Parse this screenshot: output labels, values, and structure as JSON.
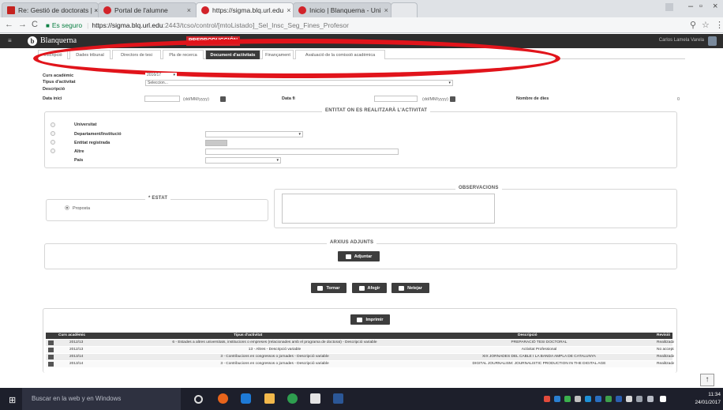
{
  "browser": {
    "tabs": [
      {
        "label": "Re: Gestió de doctorats | ×",
        "icon_color": "#c5221f"
      },
      {
        "label": "Portal de l'alumne",
        "icon_color": "#d2232a"
      },
      {
        "label": "https://sigma.blq.url.edu",
        "icon_color": "#d2232a"
      },
      {
        "label": "Inicio | Blanquerna - Uni",
        "icon_color": "#d2232a"
      }
    ],
    "secure_label": "Es seguro",
    "url_host": "https://sigma.blq.url.edu",
    "url_path": ":2443/tcso/control/[mtoListado]_Sel_Insc_Seg_Fines_Profesor"
  },
  "app": {
    "logo_letter": "b",
    "brand": "Blanquerna",
    "env_badge": "PREPRODUCCIÓN",
    "user_name": "Carlos Lamela Varela"
  },
  "subtabs": [
    "Inscripció",
    "Dades tribunal",
    "Directors de tesi",
    "Pla de recerca",
    "Document d'activitats",
    "Finançament",
    "Avaluació de la comissió acadèmica"
  ],
  "form": {
    "curs_label": "Curs acadèmic",
    "curs_value": "2016/17",
    "tipus_label": "Tipus d'activitat",
    "tipus_value": "Seleccion...",
    "descripcio_label": "Descripció",
    "data_inici_label": "Data inici",
    "data_fi_label": "Data fi",
    "date_hint": "(dd/MM/yyyy)",
    "dies_label": "Nombre de dies",
    "dies_value": "0",
    "entitat_legend": "ENTITAT ON ES REALITZARÀ L'ACTIVITAT",
    "universitat": "Universitat",
    "departament": "Departament/Institució",
    "entitat_reg": "Entitat registrada",
    "altre": "Altre",
    "pais": "País",
    "estat_legend": "* ESTAT",
    "estat_option": "Proposta",
    "observacions_legend": "OBSERVACIONS",
    "arxius_legend": "ARXIUS ADJUNTS",
    "adjuntar": "Adjuntar",
    "tornar": "Tornar",
    "alegir": "Afegir",
    "netejar": "Netejar",
    "imprimir": "Imprimir"
  },
  "table": {
    "headers": [
      "Curs acadèmic",
      "Tipus d'activitat",
      "Descripció",
      "Revisió"
    ],
    "rows": [
      [
        "2012/13",
        "6 - Estades a altres universitats, institucions o empreses (relacionades amb el programa de doctorat) - Descripció variable",
        "PREPARACIÓ TESI DOCTORAL",
        "Realitzada"
      ],
      [
        "2012/13",
        "13 - Altres - Descripció variable",
        "Activitat Professional",
        "No acceptada"
      ],
      [
        "2013/14",
        "3 - Contribucions en congressos o jornades - Descripció variable",
        "XIX JORNADES DEL CABLE I LA BANDA AMPLA DE CATALUNYA",
        "Realitzada"
      ],
      [
        "2013/14",
        "3 - Contribucions en congressos o jornades - Descripció variable",
        "DIGITAL JOURNALISM: JOURNALISTIC PRODUCTION IN THE DIGITAL AGE",
        "Realitzada"
      ]
    ]
  },
  "taskbar": {
    "search_placeholder": "Buscar en la web y en Windows",
    "time": "11:34",
    "date": "24/01/2017"
  },
  "colors": {
    "accent_red": "#d2232a",
    "annotation_red": "#e1141b",
    "header_dark": "#2d2d2d",
    "active_tab": "#3a3a3a"
  }
}
